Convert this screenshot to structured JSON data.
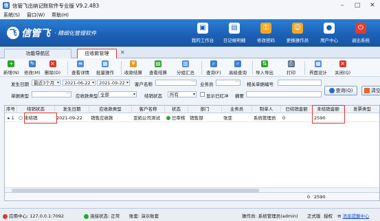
{
  "window": {
    "title": "信管飞出纳记账软件专业版 V9.2.483",
    "app_icon": "信"
  },
  "menu": [
    "系统(S)",
    "窗口(W)",
    "帮助(H)"
  ],
  "banner": {
    "logo_mark": "飞",
    "logo_name": "信管飞",
    "slogan": "· 精细化管理软件",
    "buttons": [
      {
        "label": "我的工作台",
        "icon": "desktop-icon",
        "glyph": "▣"
      },
      {
        "label": "日记帐明细",
        "icon": "ledger-icon",
        "glyph": "▤"
      },
      {
        "label": "修改密码",
        "icon": "key-icon",
        "glyph": "⚿"
      },
      {
        "label": "更换操作员",
        "icon": "user-switch-icon",
        "glyph": "☺"
      },
      {
        "label": "用户中心",
        "icon": "user-center-icon",
        "glyph": "●"
      },
      {
        "label": "退出系统",
        "icon": "power-icon",
        "glyph": "⏻"
      }
    ]
  },
  "tabs": [
    {
      "label": "功能导航区"
    },
    {
      "label": "应收款管理"
    }
  ],
  "toolbar": [
    {
      "label": "新增(N)",
      "icon": "add-icon",
      "color": "#2aa52a",
      "glyph": "+"
    },
    {
      "label": "修改(M)",
      "icon": "edit-icon",
      "color": "#3d7fd1",
      "glyph": "✎"
    },
    {
      "label": "删除(D)",
      "icon": "delete-icon",
      "color": "#d93a2c",
      "glyph": "×"
    },
    {
      "label": "查看详情",
      "icon": "detail-icon",
      "color": "#4a8be0",
      "glyph": "≡"
    },
    {
      "label": "批量操作",
      "icon": "batch-icon",
      "color": "#4a8be0",
      "glyph": "▦"
    },
    {
      "label": "收款结算",
      "icon": "settle-icon",
      "color": "#e39b2a",
      "glyph": "¥"
    },
    {
      "label": "查看结算",
      "icon": "view-settle-icon",
      "color": "#2aa52a",
      "glyph": "▤"
    },
    {
      "label": "分组汇总",
      "icon": "group-icon",
      "color": "#4a8be0",
      "glyph": "▥"
    },
    {
      "label": "查询(F)",
      "icon": "search-icon",
      "color": "#3d7fd1",
      "glyph": "⌕"
    },
    {
      "label": "高级查询",
      "icon": "advanced-search-icon",
      "color": "#3d7fd1",
      "glyph": "⌕"
    },
    {
      "label": "导入导出",
      "icon": "import-export-icon",
      "color": "#2aa52a",
      "glyph": "⇅"
    },
    {
      "label": "打印",
      "icon": "print-icon",
      "color": "#5a6f8c",
      "glyph": "⎙"
    },
    {
      "label": "界面设计",
      "icon": "design-icon",
      "color": "#4a8be0",
      "glyph": "▦"
    },
    {
      "label": "关闭(Q)",
      "icon": "close-icon",
      "color": "#d93a2c",
      "glyph": "×"
    }
  ],
  "filters": {
    "date_label": "发生日期",
    "date_range": "最近3个月",
    "date_from": "2021-06-22",
    "date_to": "2021-09-22",
    "customer_label": "客户名称",
    "customer_value": "",
    "salesman_label": "业务员",
    "salesman_value": "",
    "related_no_label": "相关单据编号",
    "related_no_value": "",
    "doc_type_label": "单据类型",
    "doc_type_value": "",
    "recv_type_label": "应收款类型",
    "recv_type_value": "全部",
    "settle_status_label": "结销状态",
    "settle_status_value": "所有",
    "show_red_label": "显示已红冲",
    "summary_label": "摘要",
    "summary_value": "",
    "query_button": "查询(Q)",
    "reset_button": "清空"
  },
  "grid": {
    "columns": [
      "序号",
      "结销状态",
      "发生日期",
      "应收款类型",
      "客户名称",
      "状态",
      "部门",
      "业务员",
      "制单人",
      "已结销金额",
      "未结销金额",
      "发票类型"
    ],
    "rows": [
      {
        "index": "1",
        "settle_status": "未结销",
        "date": "2021-09-22",
        "recv_type": "销售应收款",
        "customer": "亚拓公司测试",
        "status": "已审核",
        "department": "销售部",
        "salesman": "张亚",
        "creator": "系统管理员",
        "settled_amount": "0",
        "unsettled_amount": "2590",
        "invoice_type": ""
      }
    ],
    "totals": {
      "settled_amount": "0",
      "unsettled_amount": "2590"
    }
  },
  "statusbar": {
    "app_center": "应用中心: 127.0.0.1:7092",
    "connection": "连接状态: 正常",
    "account_set": "账套: 演示账套",
    "operator": "操作员: 系统管理员(admin)",
    "edition": "正式版",
    "register": "授权",
    "message": "消息提醒中心",
    "colors": {
      "connection_ok": "#2aa52a",
      "app_center": "#d93a2c"
    }
  }
}
